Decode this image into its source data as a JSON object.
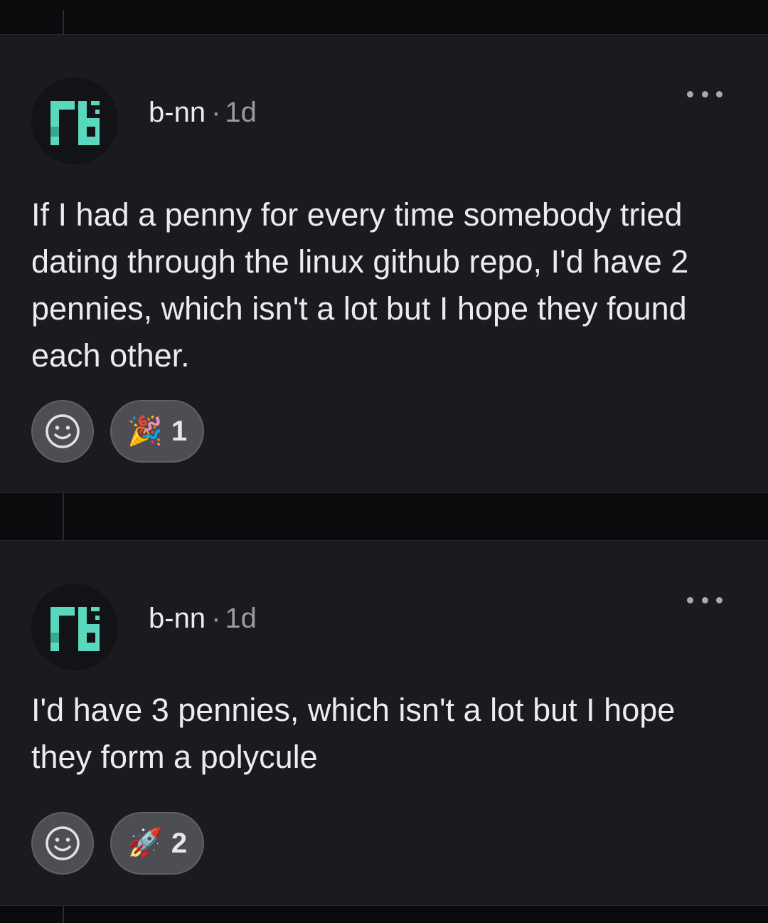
{
  "colors": {
    "background": "#0b0b0d",
    "card": "#1a1b20",
    "avatar_accent": "#5ad8bd",
    "chip": "#4d4e54",
    "muted_text": "#9a9ba2"
  },
  "comments": [
    {
      "author": "b-nn",
      "separator": "·",
      "age": "1d",
      "avatar_icon": "b-nn-logo-icon",
      "more_icon": "more-options-icon",
      "text": "If I had a penny for every time somebody tried dating through the linux github repo, I'd have 2 pennies, which isn't a lot but I hope they found each other.",
      "add_reaction_icon": "smiley-icon",
      "reaction": {
        "icon": "party-popper-icon",
        "emoji": "🎉",
        "count": "1"
      }
    },
    {
      "author": "b-nn",
      "separator": "·",
      "age": "1d",
      "avatar_icon": "b-nn-logo-icon",
      "more_icon": "more-options-icon",
      "text": "I'd have 3 pennies, which isn't a lot but I hope they form a polycule",
      "add_reaction_icon": "smiley-icon",
      "reaction": {
        "icon": "rocket-icon",
        "emoji": "🚀",
        "count": "2"
      }
    }
  ]
}
